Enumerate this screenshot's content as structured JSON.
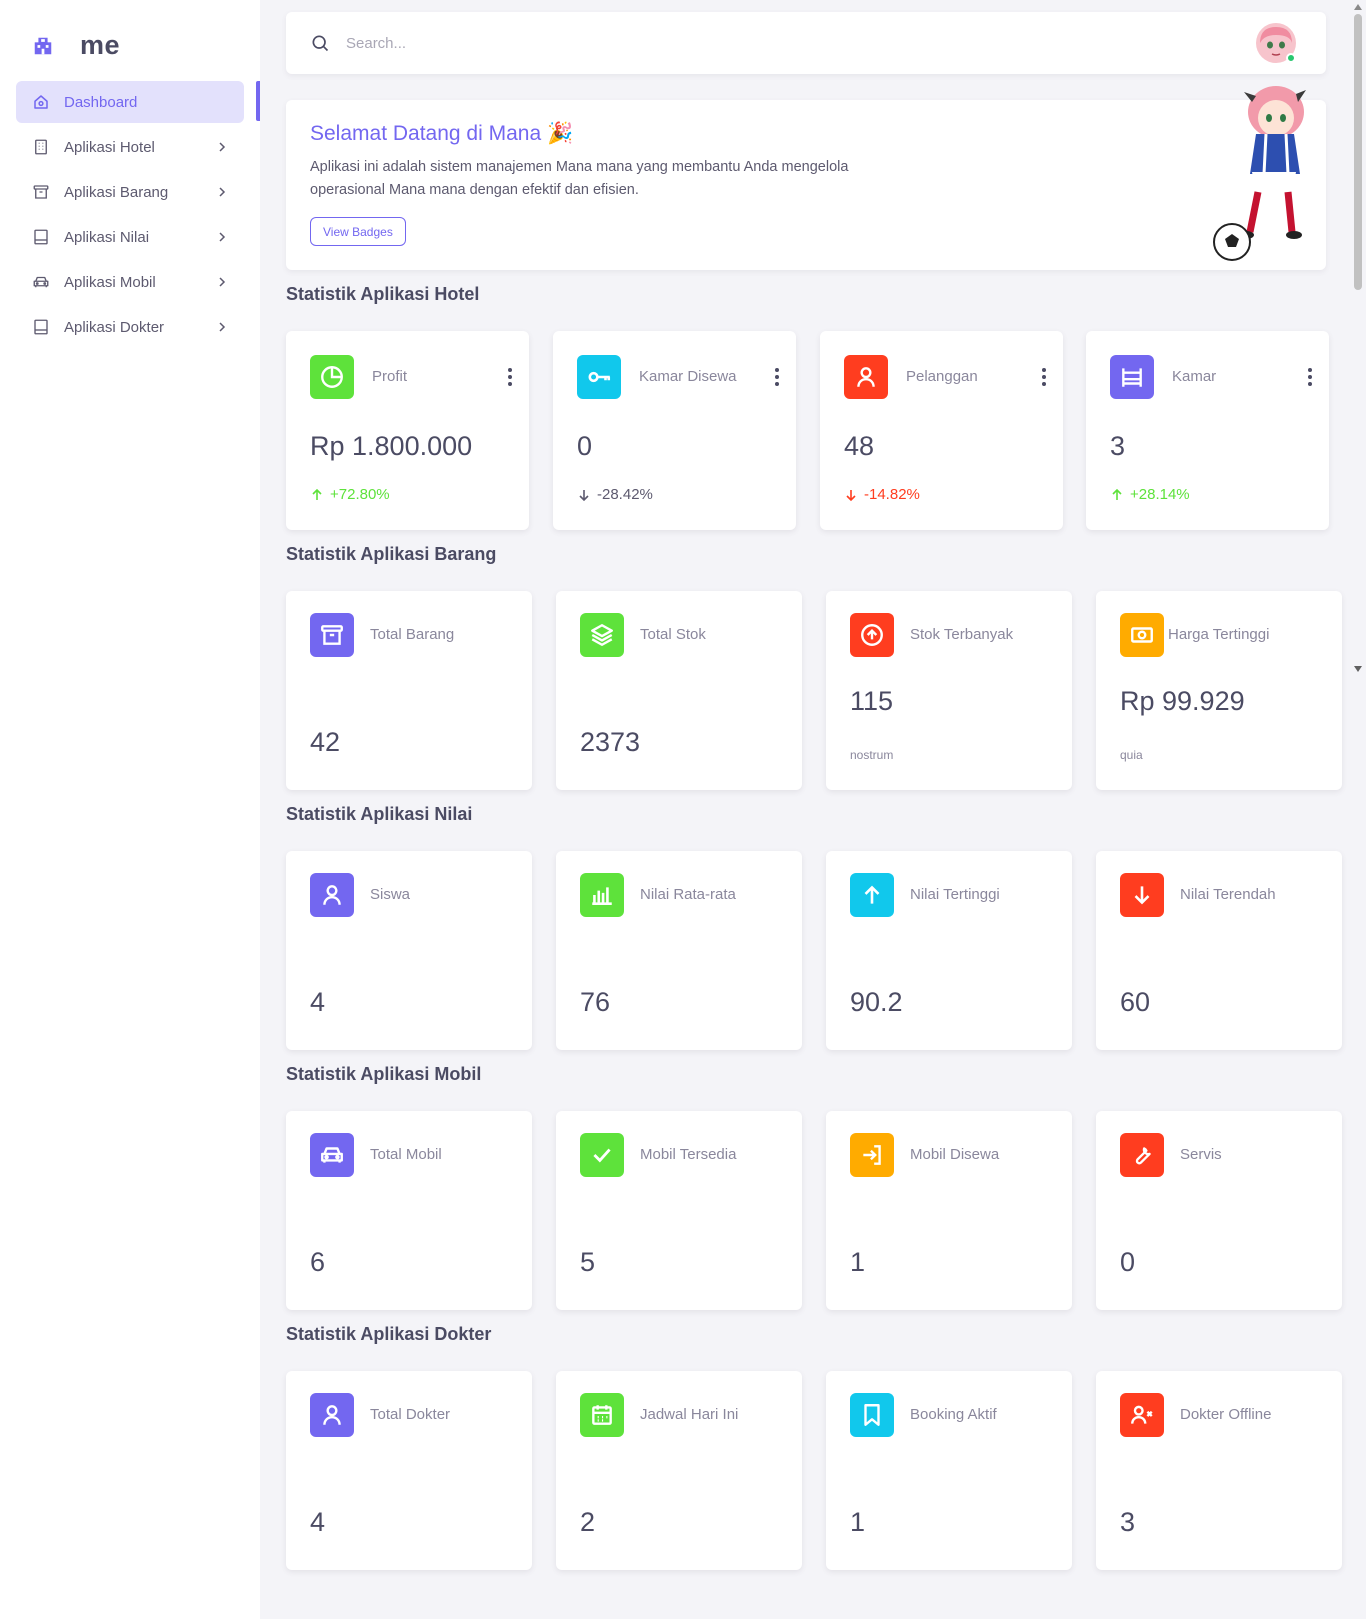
{
  "app": {
    "brand": "me"
  },
  "sidebar": {
    "items": [
      {
        "label": "Dashboard",
        "icon": "home-icon",
        "active": true
      },
      {
        "label": "Aplikasi Hotel",
        "icon": "building-icon"
      },
      {
        "label": "Aplikasi Barang",
        "icon": "archive-icon"
      },
      {
        "label": "Aplikasi Nilai",
        "icon": "book-icon"
      },
      {
        "label": "Aplikasi Mobil",
        "icon": "car-icon"
      },
      {
        "label": "Aplikasi Dokter",
        "icon": "book-icon"
      }
    ]
  },
  "search": {
    "placeholder": "Search..."
  },
  "welcome": {
    "title": "Selamat Datang di Mana 🎉",
    "description": "Aplikasi ini adalah sistem manajemen Mana mana yang membantu Anda mengelola operasional Mana mana dengan efektif dan efisien.",
    "button": "View Badges"
  },
  "colors": {
    "primary": "#7367f0",
    "success": "#28c76f",
    "danger": "#ea5455",
    "info": "#00cfe8",
    "warning": "#ff9f43",
    "green": "#5ee23b",
    "red": "#ff3d1f",
    "cyan": "#11c8ec",
    "orange": "#ffab00"
  },
  "hotel": {
    "title": "Statistik Aplikasi Hotel",
    "cards": [
      {
        "label": "Profit",
        "value": "Rp 1.800.000",
        "change": "+72.80%",
        "trend": "up",
        "icon": "pie-chart-icon"
      },
      {
        "label": "Kamar Disewa",
        "value": "0",
        "change": "-28.42%",
        "trend": "down-neutral",
        "icon": "key-icon"
      },
      {
        "label": "Pelanggan",
        "value": "48",
        "change": "-14.82%",
        "trend": "down",
        "icon": "user-icon"
      },
      {
        "label": "Kamar",
        "value": "3",
        "change": "+28.14%",
        "trend": "up",
        "icon": "bed-icon"
      }
    ]
  },
  "barang": {
    "title": "Statistik Aplikasi Barang",
    "cards": [
      {
        "label": "Total Barang",
        "value": "42",
        "icon": "archive-icon"
      },
      {
        "label": "Total Stok",
        "value": "2373",
        "icon": "stack-icon"
      },
      {
        "label": "Stok Terbanyak",
        "value": "115",
        "sub": "nostrum",
        "icon": "arrow-up-circle-icon"
      },
      {
        "label": "Harga Tertinggi",
        "value": "Rp 99.929",
        "sub": "quia",
        "icon": "cash-icon"
      }
    ]
  },
  "nilai": {
    "title": "Statistik Aplikasi Nilai",
    "cards": [
      {
        "label": "Siswa",
        "value": "4",
        "icon": "user-icon"
      },
      {
        "label": "Nilai Rata-rata",
        "value": "76",
        "icon": "bar-chart-icon"
      },
      {
        "label": "Nilai Tertinggi",
        "value": "90.2",
        "icon": "arrow-up-icon"
      },
      {
        "label": "Nilai Terendah",
        "value": "60",
        "icon": "arrow-down-icon"
      }
    ]
  },
  "mobil": {
    "title": "Statistik Aplikasi Mobil",
    "cards": [
      {
        "label": "Total Mobil",
        "value": "6",
        "icon": "car-icon"
      },
      {
        "label": "Mobil Tersedia",
        "value": "5",
        "icon": "check-icon"
      },
      {
        "label": "Mobil Disewa",
        "value": "1",
        "icon": "login-icon"
      },
      {
        "label": "Servis",
        "value": "0",
        "icon": "wrench-icon"
      }
    ]
  },
  "dokter": {
    "title": "Statistik Aplikasi Dokter",
    "cards": [
      {
        "label": "Total Dokter",
        "value": "4",
        "icon": "user-icon"
      },
      {
        "label": "Jadwal Hari Ini",
        "value": "2",
        "icon": "calendar-icon"
      },
      {
        "label": "Booking Aktif",
        "value": "1",
        "icon": "bookmark-icon"
      },
      {
        "label": "Dokter Offline",
        "value": "3",
        "icon": "user-x-icon"
      }
    ]
  }
}
